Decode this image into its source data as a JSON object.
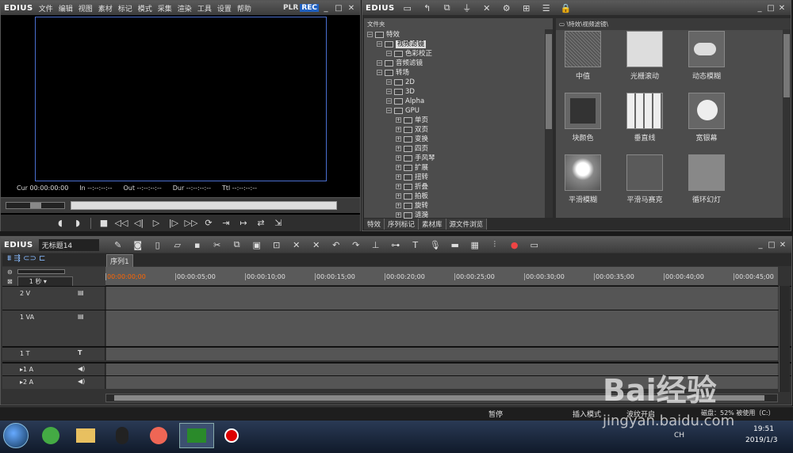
{
  "player": {
    "logo": "EDIUS",
    "menu": [
      "文件",
      "编辑",
      "视图",
      "素材",
      "标记",
      "模式",
      "采集",
      "渲染",
      "工具",
      "设置",
      "帮助"
    ],
    "plr": "PLR",
    "rec": "REC",
    "timecodes": [
      {
        "label": "Cur",
        "value": "00:00:00:00"
      },
      {
        "label": "In",
        "value": "--:--:--:--"
      },
      {
        "label": "Out",
        "value": "--:--:--:--"
      },
      {
        "label": "Dur",
        "value": "--:--:--:--"
      },
      {
        "label": "Ttl",
        "value": "--:--:--:--"
      }
    ]
  },
  "effects": {
    "logo": "EDIUS",
    "folder_header": "文件夹",
    "path": "\\特效\\视频滤镜\\",
    "tree": [
      {
        "label": "特效",
        "indent": 0
      },
      {
        "label": "视频滤镜",
        "indent": 1,
        "selected": true
      },
      {
        "label": "色彩校正",
        "indent": 2
      },
      {
        "label": "音频滤镜",
        "indent": 1
      },
      {
        "label": "转场",
        "indent": 1
      },
      {
        "label": "2D",
        "indent": 2
      },
      {
        "label": "3D",
        "indent": 2
      },
      {
        "label": "Alpha",
        "indent": 2
      },
      {
        "label": "GPU",
        "indent": 2
      },
      {
        "label": "单页",
        "indent": 3
      },
      {
        "label": "双页",
        "indent": 3
      },
      {
        "label": "变换",
        "indent": 3
      },
      {
        "label": "四页",
        "indent": 3
      },
      {
        "label": "手风琴",
        "indent": 3
      },
      {
        "label": "扩展",
        "indent": 3
      },
      {
        "label": "扭转",
        "indent": 3
      },
      {
        "label": "折叠",
        "indent": 3
      },
      {
        "label": "拍板",
        "indent": 3
      },
      {
        "label": "旋转",
        "indent": 3
      },
      {
        "label": "涟漪",
        "indent": 3
      }
    ],
    "thumbs": [
      "中值",
      "光栅滚动",
      "动态模糊",
      "块颜色",
      "垂直线",
      "宽银幕",
      "平滑模糊",
      "平滑马赛克",
      "循环幻灯"
    ],
    "tabs": [
      "特效",
      "序列标记",
      "素材库",
      "源文件浏览"
    ]
  },
  "timeline": {
    "logo": "EDIUS",
    "project": "无标题14",
    "sequence_tab": "序列1",
    "scale": "1 秒",
    "ruler": [
      "00:00:00;00",
      "00:00:05;00",
      "00:00:10;00",
      "00:00:15;00",
      "00:00:20;00",
      "00:00:25;00",
      "00:00:30;00",
      "00:00:35;00",
      "00:00:40;00",
      "00:00:45;00"
    ],
    "tracks": [
      {
        "name": "2 V",
        "icon": "▤"
      },
      {
        "name": "1 VA",
        "icon": "▤"
      },
      {
        "name": "1 T",
        "icon": "T"
      },
      {
        "name": "▸1 A",
        "icon": "◀)"
      },
      {
        "name": "▸2 A",
        "icon": "◀)"
      }
    ]
  },
  "status": {
    "pause": "暂停",
    "insert_mode": "插入模式",
    "ripple": "波纹开启",
    "disk": "磁盘：52% 被使用（C:）"
  },
  "taskbar": {
    "time": "19:51",
    "date": "2019/1/3",
    "lang": "CH"
  },
  "watermark": {
    "brand": "Bai经验",
    "url": "jingyan.baidu.com"
  }
}
